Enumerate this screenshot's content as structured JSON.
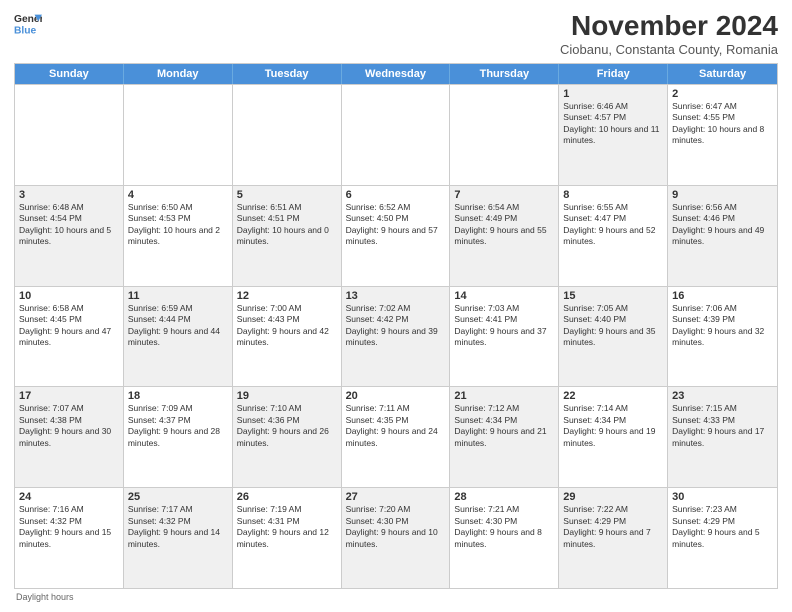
{
  "header": {
    "logo_line1": "General",
    "logo_line2": "Blue",
    "month_title": "November 2024",
    "location": "Ciobanu, Constanta County, Romania"
  },
  "days_of_week": [
    "Sunday",
    "Monday",
    "Tuesday",
    "Wednesday",
    "Thursday",
    "Friday",
    "Saturday"
  ],
  "footer": "Daylight hours",
  "weeks": [
    [
      {
        "day": "",
        "info": "",
        "shaded": false,
        "empty": true
      },
      {
        "day": "",
        "info": "",
        "shaded": false,
        "empty": true
      },
      {
        "day": "",
        "info": "",
        "shaded": false,
        "empty": true
      },
      {
        "day": "",
        "info": "",
        "shaded": false,
        "empty": true
      },
      {
        "day": "",
        "info": "",
        "shaded": false,
        "empty": true
      },
      {
        "day": "1",
        "info": "Sunrise: 6:46 AM\nSunset: 4:57 PM\nDaylight: 10 hours and 11 minutes.",
        "shaded": true,
        "empty": false
      },
      {
        "day": "2",
        "info": "Sunrise: 6:47 AM\nSunset: 4:55 PM\nDaylight: 10 hours and 8 minutes.",
        "shaded": false,
        "empty": false
      }
    ],
    [
      {
        "day": "3",
        "info": "Sunrise: 6:48 AM\nSunset: 4:54 PM\nDaylight: 10 hours and 5 minutes.",
        "shaded": true,
        "empty": false
      },
      {
        "day": "4",
        "info": "Sunrise: 6:50 AM\nSunset: 4:53 PM\nDaylight: 10 hours and 2 minutes.",
        "shaded": false,
        "empty": false
      },
      {
        "day": "5",
        "info": "Sunrise: 6:51 AM\nSunset: 4:51 PM\nDaylight: 10 hours and 0 minutes.",
        "shaded": true,
        "empty": false
      },
      {
        "day": "6",
        "info": "Sunrise: 6:52 AM\nSunset: 4:50 PM\nDaylight: 9 hours and 57 minutes.",
        "shaded": false,
        "empty": false
      },
      {
        "day": "7",
        "info": "Sunrise: 6:54 AM\nSunset: 4:49 PM\nDaylight: 9 hours and 55 minutes.",
        "shaded": true,
        "empty": false
      },
      {
        "day": "8",
        "info": "Sunrise: 6:55 AM\nSunset: 4:47 PM\nDaylight: 9 hours and 52 minutes.",
        "shaded": false,
        "empty": false
      },
      {
        "day": "9",
        "info": "Sunrise: 6:56 AM\nSunset: 4:46 PM\nDaylight: 9 hours and 49 minutes.",
        "shaded": true,
        "empty": false
      }
    ],
    [
      {
        "day": "10",
        "info": "Sunrise: 6:58 AM\nSunset: 4:45 PM\nDaylight: 9 hours and 47 minutes.",
        "shaded": false,
        "empty": false
      },
      {
        "day": "11",
        "info": "Sunrise: 6:59 AM\nSunset: 4:44 PM\nDaylight: 9 hours and 44 minutes.",
        "shaded": true,
        "empty": false
      },
      {
        "day": "12",
        "info": "Sunrise: 7:00 AM\nSunset: 4:43 PM\nDaylight: 9 hours and 42 minutes.",
        "shaded": false,
        "empty": false
      },
      {
        "day": "13",
        "info": "Sunrise: 7:02 AM\nSunset: 4:42 PM\nDaylight: 9 hours and 39 minutes.",
        "shaded": true,
        "empty": false
      },
      {
        "day": "14",
        "info": "Sunrise: 7:03 AM\nSunset: 4:41 PM\nDaylight: 9 hours and 37 minutes.",
        "shaded": false,
        "empty": false
      },
      {
        "day": "15",
        "info": "Sunrise: 7:05 AM\nSunset: 4:40 PM\nDaylight: 9 hours and 35 minutes.",
        "shaded": true,
        "empty": false
      },
      {
        "day": "16",
        "info": "Sunrise: 7:06 AM\nSunset: 4:39 PM\nDaylight: 9 hours and 32 minutes.",
        "shaded": false,
        "empty": false
      }
    ],
    [
      {
        "day": "17",
        "info": "Sunrise: 7:07 AM\nSunset: 4:38 PM\nDaylight: 9 hours and 30 minutes.",
        "shaded": true,
        "empty": false
      },
      {
        "day": "18",
        "info": "Sunrise: 7:09 AM\nSunset: 4:37 PM\nDaylight: 9 hours and 28 minutes.",
        "shaded": false,
        "empty": false
      },
      {
        "day": "19",
        "info": "Sunrise: 7:10 AM\nSunset: 4:36 PM\nDaylight: 9 hours and 26 minutes.",
        "shaded": true,
        "empty": false
      },
      {
        "day": "20",
        "info": "Sunrise: 7:11 AM\nSunset: 4:35 PM\nDaylight: 9 hours and 24 minutes.",
        "shaded": false,
        "empty": false
      },
      {
        "day": "21",
        "info": "Sunrise: 7:12 AM\nSunset: 4:34 PM\nDaylight: 9 hours and 21 minutes.",
        "shaded": true,
        "empty": false
      },
      {
        "day": "22",
        "info": "Sunrise: 7:14 AM\nSunset: 4:34 PM\nDaylight: 9 hours and 19 minutes.",
        "shaded": false,
        "empty": false
      },
      {
        "day": "23",
        "info": "Sunrise: 7:15 AM\nSunset: 4:33 PM\nDaylight: 9 hours and 17 minutes.",
        "shaded": true,
        "empty": false
      }
    ],
    [
      {
        "day": "24",
        "info": "Sunrise: 7:16 AM\nSunset: 4:32 PM\nDaylight: 9 hours and 15 minutes.",
        "shaded": false,
        "empty": false
      },
      {
        "day": "25",
        "info": "Sunrise: 7:17 AM\nSunset: 4:32 PM\nDaylight: 9 hours and 14 minutes.",
        "shaded": true,
        "empty": false
      },
      {
        "day": "26",
        "info": "Sunrise: 7:19 AM\nSunset: 4:31 PM\nDaylight: 9 hours and 12 minutes.",
        "shaded": false,
        "empty": false
      },
      {
        "day": "27",
        "info": "Sunrise: 7:20 AM\nSunset: 4:30 PM\nDaylight: 9 hours and 10 minutes.",
        "shaded": true,
        "empty": false
      },
      {
        "day": "28",
        "info": "Sunrise: 7:21 AM\nSunset: 4:30 PM\nDaylight: 9 hours and 8 minutes.",
        "shaded": false,
        "empty": false
      },
      {
        "day": "29",
        "info": "Sunrise: 7:22 AM\nSunset: 4:29 PM\nDaylight: 9 hours and 7 minutes.",
        "shaded": true,
        "empty": false
      },
      {
        "day": "30",
        "info": "Sunrise: 7:23 AM\nSunset: 4:29 PM\nDaylight: 9 hours and 5 minutes.",
        "shaded": false,
        "empty": false
      }
    ]
  ]
}
